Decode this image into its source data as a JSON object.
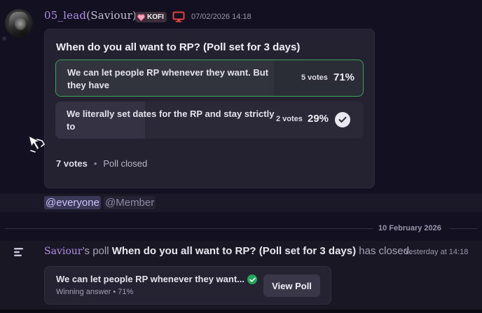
{
  "message": {
    "author": "05_lead",
    "nickname": "(Saviour)",
    "tag": "KOFI",
    "timestamp": "07/02/2026 14:18"
  },
  "poll": {
    "question": "When do you all want to RP? (Poll set for 3 days)",
    "options": [
      {
        "text": "We can let people RP whenever they want. But they have",
        "votes": "5 votes",
        "percent": "71%",
        "fill": 0.71,
        "winner": true
      },
      {
        "text": "We literally set dates for the RP and stay strictly to",
        "votes": "2 votes",
        "percent": "29%",
        "fill": 0.29,
        "winner": false
      }
    ],
    "total_votes": "7 votes",
    "status": "Poll closed"
  },
  "mentions": [
    "@everyone",
    "@Member"
  ],
  "divider": {
    "date": "10 February 2026"
  },
  "result": {
    "author": "Saviour",
    "owner_suffix": "’s poll",
    "question": "When do you all want to RP? (Poll set for 3 days)",
    "closed_text": "has closed.",
    "timestamp": "Yesterday at 14:18",
    "winning_answer": "We can let people RP whenever they want...",
    "winning_label": "Winning answer • 71%",
    "button": "View Poll"
  },
  "colors": {
    "background": "#121021",
    "username": "#b08ee8",
    "winner_border": "#3ba55c",
    "mention_everyone": "#c8c6ff",
    "check_green": "#23a55a"
  }
}
